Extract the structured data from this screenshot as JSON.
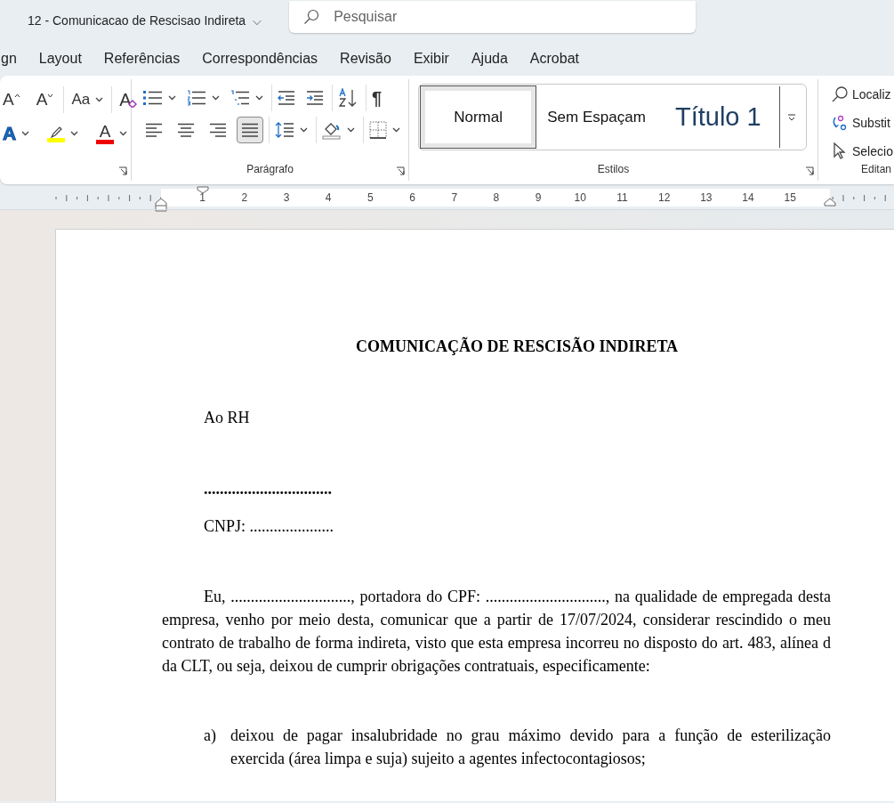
{
  "title_bar": {
    "document_title": "12 - Comunicacao de Rescisao Indireta",
    "title_caret": "⌵",
    "search": {
      "placeholder": "Pesquisar"
    }
  },
  "menu_tabs": [
    "gn",
    "Layout",
    "Referências",
    "Correspondências",
    "Revisão",
    "Exibir",
    "Ajuda",
    "Acrobat"
  ],
  "ribbon": {
    "font_group": {
      "row_1": [
        {
          "kind": "grow",
          "glyph": "A"
        },
        {
          "kind": "shrink",
          "glyph": "A"
        },
        {
          "kind": "case",
          "glyph": "Aa"
        },
        {
          "kind": "clear",
          "glyph": "A"
        }
      ],
      "row_2": [
        {
          "kind": "effects",
          "glyph": "A"
        },
        {
          "kind": "highlight",
          "color": "#ffff00"
        },
        {
          "kind": "fontcolor",
          "glyph": "A",
          "color": "#ee0000"
        }
      ]
    },
    "paragraph_group": {
      "label": "Parágrafo",
      "row_1": [
        {
          "kind": "bullets"
        },
        {
          "kind": "numbering"
        },
        {
          "kind": "multilevel"
        },
        {
          "kind": "outdent"
        },
        {
          "kind": "indent"
        },
        {
          "kind": "sort"
        },
        {
          "kind": "pilcrow",
          "glyph": "¶"
        }
      ],
      "alignment": [
        {
          "kind": "left",
          "selected": false
        },
        {
          "kind": "center",
          "selected": false
        },
        {
          "kind": "right",
          "selected": false
        },
        {
          "kind": "justify",
          "selected": true
        }
      ],
      "row_2": [
        {
          "kind": "spacing"
        },
        {
          "kind": "shading"
        },
        {
          "kind": "borders"
        }
      ]
    },
    "styles_group": {
      "label": "Estilos",
      "styles": [
        {
          "label": "Normal",
          "kind": "normal",
          "selected": true
        },
        {
          "label": "Sem Espaçam",
          "kind": "nospacing",
          "selected": false
        },
        {
          "label": "Título 1",
          "kind": "heading",
          "selected": false
        }
      ]
    },
    "editing_group": {
      "label": "Editan",
      "items": [
        {
          "kind": "find",
          "label": "Localiz"
        },
        {
          "kind": "replace",
          "label": "Substit"
        },
        {
          "kind": "select",
          "label": "Selecio"
        }
      ]
    }
  },
  "ruler": {
    "numbers": [
      "1",
      "2",
      "3",
      "4",
      "5",
      "6",
      "7",
      "8",
      "9",
      "10",
      "11",
      "12",
      "13",
      "14",
      "15"
    ]
  },
  "document": {
    "title": "COMUNICAÇÃO DE RESCISÃO INDIRETA",
    "addressee": "Ao RH",
    "company_line": "................................",
    "cnpj_line": "CNPJ: .....................",
    "body": "Eu, .............................., portadora do CPF: .............................., na qualidade de empregada desta empresa, venho por meio desta, comunicar que a partir de 17/07/2024, considerar rescindido o meu contrato de trabalho de forma indireta, visto que esta empresa incorreu no disposto do art. 483, alínea d da CLT, ou seja, deixou de cumprir obrigações contratuais, especificamente:",
    "list": [
      {
        "marker": "a)",
        "text": "deixou de pagar insalubridade no grau máximo devido para a função de esterilização exercida (área limpa e suja) sujeito a agentes infectocontagiosos;"
      }
    ]
  }
}
